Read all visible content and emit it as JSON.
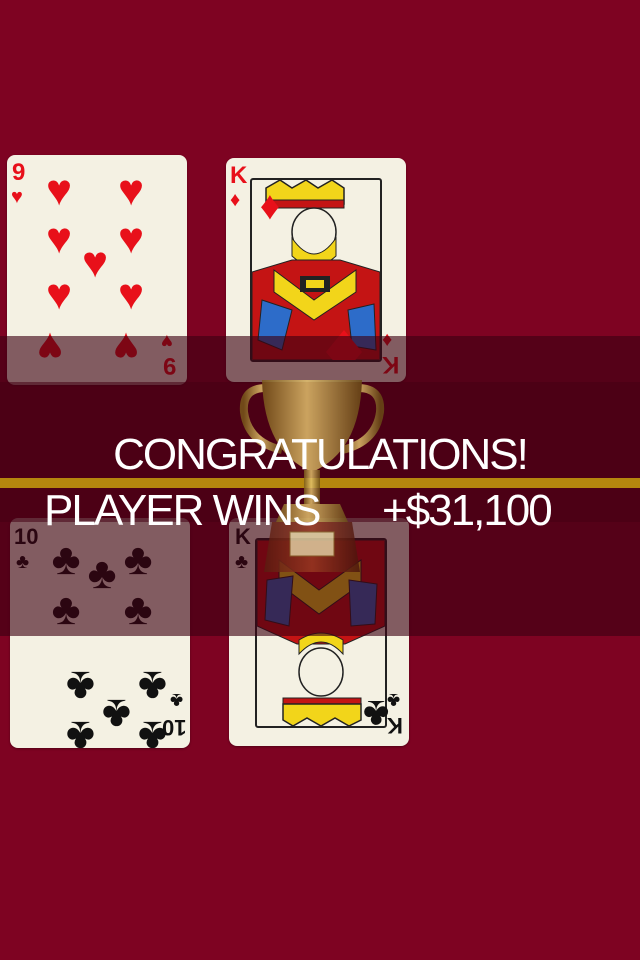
{
  "cards": [
    {
      "rank": "9",
      "suit": "hearts",
      "suit_glyph": "♥",
      "color": "#e8101a"
    },
    {
      "rank": "K",
      "suit": "diamonds",
      "suit_glyph": "♦",
      "color": "#e8101a"
    },
    {
      "rank": "10",
      "suit": "clubs",
      "suit_glyph": "♣",
      "color": "#111111"
    },
    {
      "rank": "K",
      "suit": "clubs",
      "suit_glyph": "♣",
      "color": "#111111"
    }
  ],
  "overlay": {
    "title": "CONGRATULATIONS!",
    "result_label": "PLAYER WINS",
    "amount": "+$31,100",
    "icon": "trophy-icon"
  },
  "colors": {
    "table": "#7e0322",
    "band": "#4a0218",
    "gold_line": "#b5860e",
    "text": "#ffffff"
  }
}
